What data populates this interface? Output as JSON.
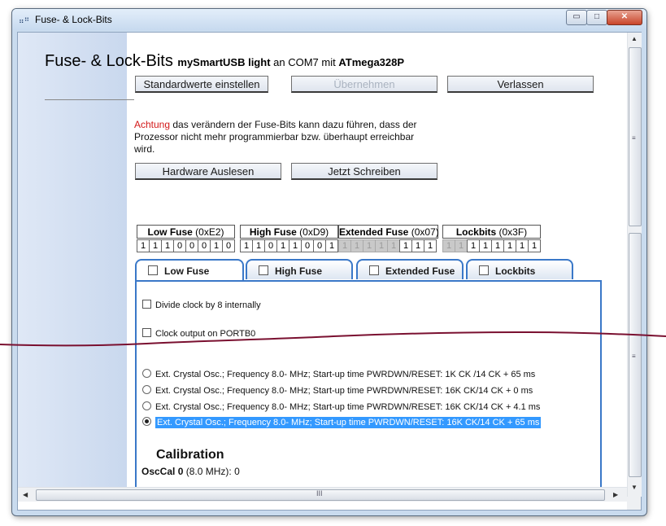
{
  "window": {
    "title": "Fuse- & Lock-Bits",
    "icon": "app-icon",
    "controls": {
      "minimize": "▭",
      "maximize": "□",
      "close": "✕"
    }
  },
  "header": {
    "title": "Fuse- & Lock-Bits",
    "device": "mySmartUSB light",
    "conn_text": "an COM7 mit",
    "mcu": "ATmega328P"
  },
  "buttons": {
    "defaults": "Standardwerte einstellen",
    "apply": "Übernehmen",
    "exit": "Verlassen",
    "read_hw": "Hardware Auslesen",
    "write_now": "Jetzt Schreiben"
  },
  "warning": {
    "prefix": "Achtung",
    "text": " das verändern der Fuse-Bits kann dazu führen, dass der Prozessor nicht mehr programmierbar bzw. überhaupt erreichbar wird."
  },
  "fuses": [
    {
      "name": "Low Fuse",
      "value": "(0xE2)",
      "bits": [
        "1",
        "1",
        "1",
        "0",
        "0",
        "0",
        "1",
        "0"
      ],
      "disabled": [
        false,
        false,
        false,
        false,
        false,
        false,
        false,
        false
      ]
    },
    {
      "name": "High Fuse",
      "value": "(0xD9)",
      "bits": [
        "1",
        "1",
        "0",
        "1",
        "1",
        "0",
        "0",
        "1"
      ],
      "disabled": [
        false,
        false,
        false,
        false,
        false,
        false,
        false,
        false
      ]
    },
    {
      "name": "Extended Fuse",
      "value": "(0x07)",
      "bits": [
        "1",
        "1",
        "1",
        "1",
        "1",
        "1",
        "1",
        "1"
      ],
      "disabled": [
        true,
        true,
        true,
        true,
        true,
        false,
        false,
        false
      ]
    },
    {
      "name": "Lockbits",
      "value": "(0x3F)",
      "bits": [
        "1",
        "1",
        "1",
        "1",
        "1",
        "1",
        "1",
        "1"
      ],
      "disabled": [
        true,
        true,
        false,
        false,
        false,
        false,
        false,
        false
      ]
    }
  ],
  "tabs": [
    {
      "label": "Low Fuse",
      "active": true
    },
    {
      "label": "High Fuse",
      "active": false
    },
    {
      "label": "Extended Fuse",
      "active": false
    },
    {
      "label": "Lockbits",
      "active": false
    }
  ],
  "low_fuse_panel": {
    "checkboxes": [
      {
        "label": "Divide clock by 8 internally",
        "checked": false
      },
      {
        "label": "Clock output on PORTB0",
        "checked": false
      }
    ],
    "radios": [
      {
        "label": "Ext. Crystal Osc.; Frequency 8.0- MHz; Start-up time PWRDWN/RESET: 1K CK /14 CK + 65 ms",
        "selected": false
      },
      {
        "label": "Ext. Crystal Osc.; Frequency 8.0- MHz; Start-up time PWRDWN/RESET: 16K CK/14 CK + 0 ms",
        "selected": false
      },
      {
        "label": "Ext. Crystal Osc.; Frequency 8.0- MHz; Start-up time PWRDWN/RESET: 16K CK/14 CK + 4.1 ms",
        "selected": false
      },
      {
        "label": "Ext. Crystal Osc.; Frequency 8.0- MHz; Start-up time PWRDWN/RESET: 16K CK/14 CK + 65 ms",
        "selected": true
      }
    ],
    "calibration_title": "Calibration",
    "osccal_label": "OscCal 0",
    "osccal_freq": "(8.0 MHz):",
    "osccal_value": "0"
  },
  "scrollbar": {
    "up": "▲",
    "down": "▼",
    "left": "◀",
    "right": "▶",
    "grip": "≡",
    "hgrip": "III"
  },
  "colors": {
    "accent": "#3a78c8",
    "selection": "#3399ff",
    "warning_red": "#d31919",
    "tear_line": "#7a1030"
  }
}
